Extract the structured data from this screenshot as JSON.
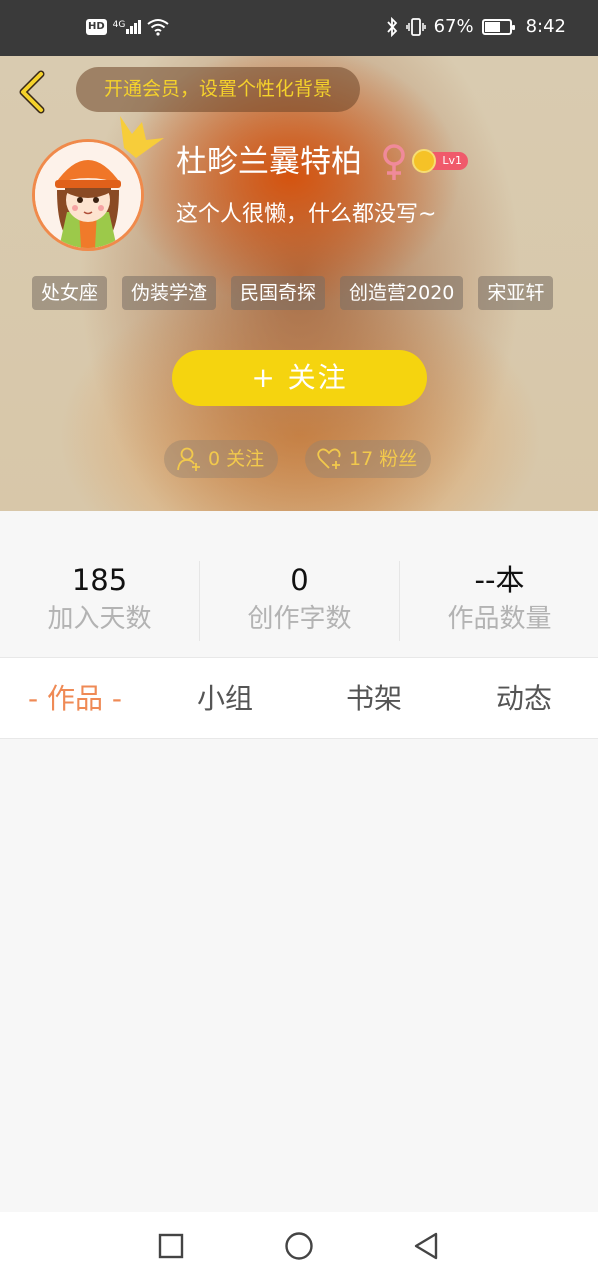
{
  "status_bar": {
    "network": "HD",
    "signal_type": "4G",
    "battery_percent": "67%",
    "time": "8:42",
    "icons": [
      "bluetooth-icon",
      "vibrate-icon",
      "wifi-icon",
      "battery-icon"
    ]
  },
  "header": {
    "vip_banner": "开通会员，设置个性化背景",
    "username": "杜畛兰曩特柏",
    "gender_symbol": "♀",
    "level": "Lv1",
    "bio": "这个人很懒，什么都没写~",
    "tags": [
      "处女座",
      "伪装学渣",
      "民国奇探",
      "创造营2020",
      "宋亚轩"
    ],
    "follow_button": "+   关注",
    "following": "0 关注",
    "followers": "17 粉丝"
  },
  "stats": [
    {
      "value": "185",
      "label": "加入天数"
    },
    {
      "value": "0",
      "label": "创作字数"
    },
    {
      "value": "--本",
      "label": "作品数量"
    }
  ],
  "tabs": [
    {
      "label": "- 作品 -",
      "active": true
    },
    {
      "label": "小组",
      "active": false
    },
    {
      "label": "书架",
      "active": false
    },
    {
      "label": "动态",
      "active": false
    }
  ],
  "colors": {
    "accent_yellow": "#f5d40f",
    "active_tab": "#ef8a55",
    "banner_text": "#f5d22b"
  }
}
